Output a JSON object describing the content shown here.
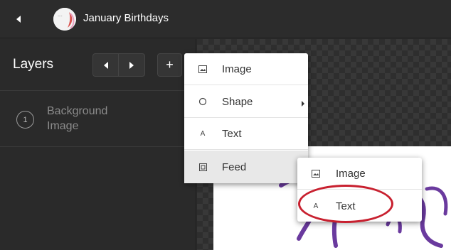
{
  "header": {
    "title": "January Birthdays"
  },
  "layers": {
    "title": "Layers",
    "add_label": "+",
    "items": [
      {
        "number": "1",
        "name": "Background Image"
      }
    ]
  },
  "add_menu": {
    "items": [
      {
        "label": "Image",
        "icon": "image-icon"
      },
      {
        "label": "Shape",
        "icon": "circle-icon",
        "has_submenu": true
      },
      {
        "label": "Text",
        "icon": "text-icon"
      },
      {
        "label": "Feed",
        "icon": "feed-icon",
        "active": true
      }
    ]
  },
  "feed_submenu": {
    "items": [
      {
        "label": "Image",
        "icon": "image-icon"
      },
      {
        "label": "Text",
        "icon": "text-icon",
        "highlighted": true
      }
    ]
  },
  "colors": {
    "topbar_bg": "#2c2c2c",
    "panel_bg": "#2a2a2a",
    "menu_bg": "#ffffff",
    "active_item_bg": "#e8e8e8",
    "highlight_ring": "#c8202f",
    "script_text": "#6a3a9e"
  }
}
